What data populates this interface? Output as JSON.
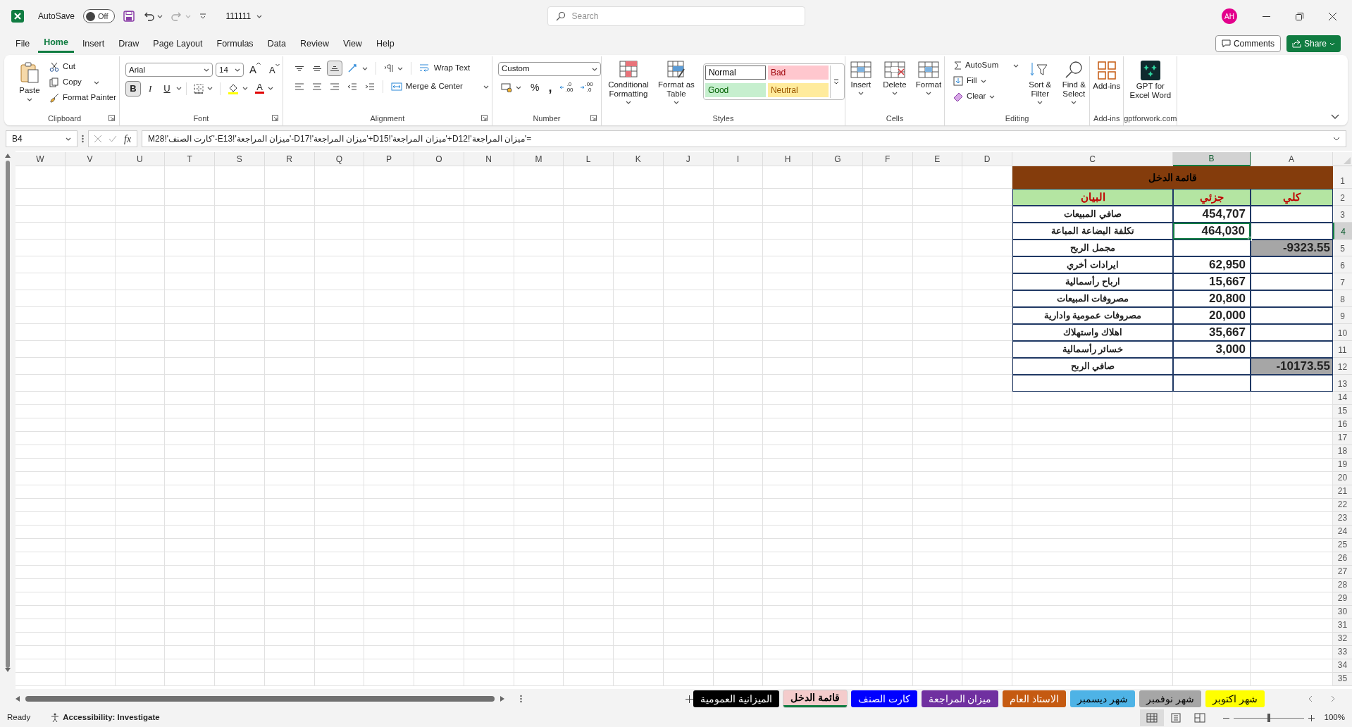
{
  "title_bar": {
    "autosave_label": "AutoSave",
    "autosave": {
      "on": false,
      "text": "Off"
    },
    "file_name": "111111",
    "search_placeholder": "Search",
    "avatar": "AH"
  },
  "menu_tabs": [
    {
      "label": "File",
      "selected": false
    },
    {
      "label": "Home",
      "selected": true
    },
    {
      "label": "Insert",
      "selected": false
    },
    {
      "label": "Draw",
      "selected": false
    },
    {
      "label": "Page Layout",
      "selected": false
    },
    {
      "label": "Formulas",
      "selected": false
    },
    {
      "label": "Data",
      "selected": false
    },
    {
      "label": "Review",
      "selected": false
    },
    {
      "label": "View",
      "selected": false
    },
    {
      "label": "Help",
      "selected": false
    }
  ],
  "comments_button": "Comments",
  "share_button": "Share",
  "ribbon": {
    "clipboard": {
      "paste": "Paste",
      "cut": "Cut",
      "copy": "Copy",
      "format_painter": "Format Painter",
      "label": "Clipboard"
    },
    "font": {
      "font_name": "Arial",
      "font_size": "14",
      "grow_font": "A",
      "shrink_font": "A",
      "font_color": "A",
      "label": "Font",
      "style_buttons": [
        {
          "label": "B",
          "kind": "bold",
          "active": true
        },
        {
          "label": "I",
          "kind": "italic",
          "active": false
        },
        {
          "label": "U",
          "kind": "underline",
          "active": false
        }
      ]
    },
    "alignment": {
      "vertical_align_buttons": [
        {
          "kind": "top",
          "selected": false
        },
        {
          "kind": "middle",
          "selected": false
        },
        {
          "kind": "bottom",
          "selected": true
        }
      ],
      "wrap_text": "Wrap Text",
      "merge_center": "Merge & Center",
      "label": "Alignment"
    },
    "number": {
      "format": "Custom",
      "percent": "%",
      "comma": ",",
      "decimal_buttons": [
        {
          "kind": "increase",
          "top": ".0",
          "bottom": ".00"
        },
        {
          "kind": "decrease",
          "top": ".00",
          "bottom": ".0"
        }
      ],
      "label": "Number"
    },
    "styles": {
      "conditional_formatting": "Conditional Formatting",
      "format_as_table": "Format as Table",
      "label": "Styles",
      "cell_styles": [
        {
          "label": "Normal",
          "kind": "normal"
        },
        {
          "label": "Bad",
          "kind": "bad"
        },
        {
          "label": "Good",
          "kind": "good"
        },
        {
          "label": "Neutral",
          "kind": "neutral"
        }
      ]
    },
    "cells": {
      "buttons": [
        {
          "label": "Insert",
          "kind": "insert"
        },
        {
          "label": "Delete",
          "kind": "delete"
        },
        {
          "label": "Format",
          "kind": "format"
        }
      ],
      "label": "Cells"
    },
    "editing": {
      "autosum": "AutoSum",
      "fill": "Fill",
      "clear": "Clear",
      "sort_filter": "Sort & Filter",
      "find_select": "Find & Select",
      "label": "Editing"
    },
    "addins": {
      "button": "Add-ins",
      "label": "Add-ins"
    },
    "gpt": {
      "button": "GPT for Excel Word",
      "label": "gptforwork.com"
    }
  },
  "formula_bar": {
    "name_box": "B4",
    "function_label": "fx",
    "formula": "='ميزان المراجعة'!D12+'ميزان المراجعة'!D15+'ميزان المراجعة'!D17-'ميزان المراجعة'!E13-'كارت الصنف'!M28"
  },
  "columns": [
    {
      "label": "W",
      "selected": false
    },
    {
      "label": "V",
      "selected": false
    },
    {
      "label": "U",
      "selected": false
    },
    {
      "label": "T",
      "selected": false
    },
    {
      "label": "S",
      "selected": false
    },
    {
      "label": "R",
      "selected": false
    },
    {
      "label": "Q",
      "selected": false
    },
    {
      "label": "P",
      "selected": false
    },
    {
      "label": "O",
      "selected": false
    },
    {
      "label": "N",
      "selected": false
    },
    {
      "label": "M",
      "selected": false
    },
    {
      "label": "L",
      "selected": false
    },
    {
      "label": "K",
      "selected": false
    },
    {
      "label": "J",
      "selected": false
    },
    {
      "label": "I",
      "selected": false
    },
    {
      "label": "H",
      "selected": false
    },
    {
      "label": "G",
      "selected": false
    },
    {
      "label": "F",
      "selected": false
    },
    {
      "label": "E",
      "selected": false
    },
    {
      "label": "D",
      "selected": false
    },
    {
      "label": "C",
      "selected": false
    },
    {
      "label": "B",
      "selected": true
    },
    {
      "label": "A",
      "selected": false
    }
  ],
  "row_numbers": [
    {
      "label": "1",
      "selected": false
    },
    {
      "label": "2",
      "selected": false
    },
    {
      "label": "3",
      "selected": false
    },
    {
      "label": "4",
      "selected": true
    },
    {
      "label": "5",
      "selected": false
    },
    {
      "label": "6",
      "selected": false
    },
    {
      "label": "7",
      "selected": false
    },
    {
      "label": "8",
      "selected": false
    },
    {
      "label": "9",
      "selected": false
    },
    {
      "label": "10",
      "selected": false
    },
    {
      "label": "11",
      "selected": false
    },
    {
      "label": "12",
      "selected": false
    },
    {
      "label": "13",
      "selected": false
    },
    {
      "label": "14",
      "selected": false
    },
    {
      "label": "15",
      "selected": false
    },
    {
      "label": "16",
      "selected": false
    },
    {
      "label": "17",
      "selected": false
    },
    {
      "label": "18",
      "selected": false
    },
    {
      "label": "19",
      "selected": false
    },
    {
      "label": "20",
      "selected": false
    },
    {
      "label": "21",
      "selected": false
    },
    {
      "label": "22",
      "selected": false
    },
    {
      "label": "23",
      "selected": false
    },
    {
      "label": "24",
      "selected": false
    },
    {
      "label": "25",
      "selected": false
    },
    {
      "label": "26",
      "selected": false
    },
    {
      "label": "27",
      "selected": false
    },
    {
      "label": "28",
      "selected": false
    },
    {
      "label": "29",
      "selected": false
    },
    {
      "label": "30",
      "selected": false
    },
    {
      "label": "31",
      "selected": false
    },
    {
      "label": "32",
      "selected": false
    },
    {
      "label": "33",
      "selected": false
    },
    {
      "label": "34",
      "selected": false
    },
    {
      "label": "35",
      "selected": false
    }
  ],
  "sheet": {
    "title": "قائمة الدخل",
    "header": {
      "statement": "البيان",
      "partial": "جزئي",
      "total": "كلي"
    },
    "rows": [
      {
        "statement": "صافي المبيعات",
        "partial": "454,707",
        "shaded": false,
        "selected": false
      },
      {
        "statement": "تكلفة البضاعة المباعة",
        "partial": "464,030",
        "shaded": false,
        "selected": true
      },
      {
        "statement": "مجمل الربح",
        "total": "-9323.55",
        "shaded": true,
        "selected": false
      },
      {
        "statement": "ايرادات أخري",
        "partial": "62,950",
        "shaded": false,
        "selected": false
      },
      {
        "statement": "ارباح رأسمالية",
        "partial": "15,667",
        "shaded": false,
        "selected": false
      },
      {
        "statement": "مصروفات المبيعات",
        "partial": "20,800",
        "shaded": false,
        "selected": false
      },
      {
        "statement": "مصروفات عمومية وادارية",
        "partial": "20,000",
        "shaded": false,
        "selected": false
      },
      {
        "statement": "اهلاك واستهلاك",
        "partial": "35,667",
        "shaded": false,
        "selected": false
      },
      {
        "statement": "خسائر رأسمالية",
        "partial": "3,000",
        "shaded": false,
        "selected": false
      },
      {
        "statement": "صافي الربح",
        "total": "-10173.55",
        "shaded": true,
        "selected": false
      },
      {
        "shaded": false,
        "selected": false
      }
    ]
  },
  "sheet_tabs": [
    {
      "label": "شهر اكتوبر",
      "color": "#ffff00",
      "selected": false
    },
    {
      "label": "شهر نوفمبر",
      "color": "#a6a6a6",
      "selected": false
    },
    {
      "label": "شهر ديسمبر",
      "color": "#4eb3e6",
      "selected": false
    },
    {
      "label": "الاستاذ العام",
      "color": "#c55a11",
      "selected": false
    },
    {
      "label": "ميزان المراجعة",
      "color": "#7030a0",
      "selected": false
    },
    {
      "label": "كارت الصنف",
      "color": "#0000ff",
      "selected": false
    },
    {
      "label": "قائمة الدخل",
      "color": "#f4cccc",
      "selected": true
    },
    {
      "label": "الميزانية العمومية",
      "color": "#000000",
      "selected": false
    }
  ],
  "status_bar": {
    "status": "Ready",
    "accessibility": "Accessibility: Investigate",
    "views": [
      {
        "kind": "normal",
        "selected": true
      },
      {
        "kind": "page_layout",
        "selected": false
      },
      {
        "kind": "page_break",
        "selected": false
      }
    ],
    "zoom": {
      "level": 0.5
    },
    "zoom_text": "100%"
  }
}
